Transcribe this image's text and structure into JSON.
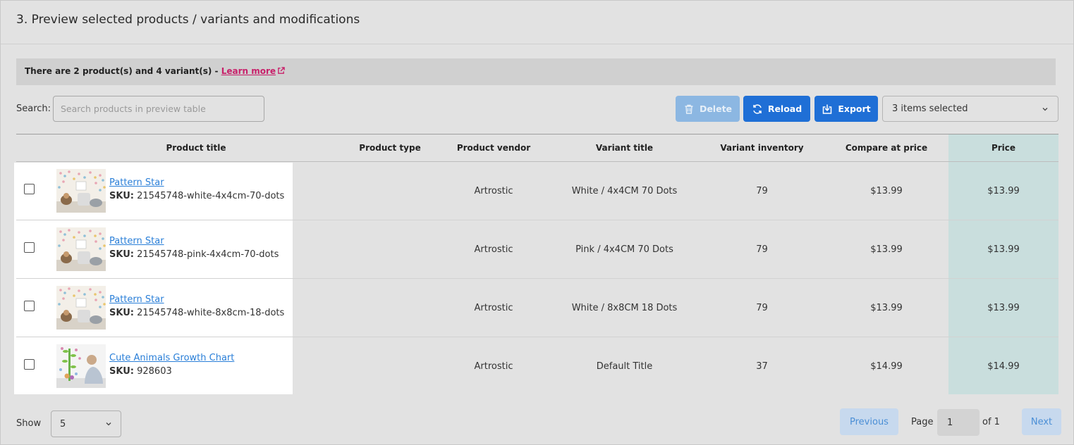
{
  "section_title": "3. Preview selected products / variants and modifications",
  "info": {
    "text": "There are 2 product(s) and 4 variant(s) - ",
    "link_label": "Learn more"
  },
  "search": {
    "label": "Search:",
    "placeholder": "Search products in preview table"
  },
  "toolbar": {
    "delete_label": "Delete",
    "reload_label": "Reload",
    "export_label": "Export",
    "selection_value": "3 items selected"
  },
  "table": {
    "columns": [
      "Product title",
      "Product type",
      "Product vendor",
      "Variant title",
      "Variant inventory",
      "Compare at price",
      "Price"
    ],
    "sku_label": "SKU:",
    "rows": [
      {
        "title": "Pattern Star",
        "sku": "21545748-white-4x4cm-70-dots",
        "type": "",
        "vendor": "Artrostic",
        "variant": "White / 4x4CM 70 Dots",
        "inventory": "79",
        "compare": "$13.99",
        "price": "$13.99",
        "image": "pattern-star"
      },
      {
        "title": "Pattern Star",
        "sku": "21545748-pink-4x4cm-70-dots",
        "type": "",
        "vendor": "Artrostic",
        "variant": "Pink / 4x4CM 70 Dots",
        "inventory": "79",
        "compare": "$13.99",
        "price": "$13.99",
        "image": "pattern-star"
      },
      {
        "title": "Pattern Star",
        "sku": "21545748-white-8x8cm-18-dots",
        "type": "",
        "vendor": "Artrostic",
        "variant": "White / 8x8CM 18 Dots",
        "inventory": "79",
        "compare": "$13.99",
        "price": "$13.99",
        "image": "pattern-star"
      },
      {
        "title": "Cute Animals Growth Chart",
        "sku": "928603",
        "type": "",
        "vendor": "Artrostic",
        "variant": "Default Title",
        "inventory": "37",
        "compare": "$14.99",
        "price": "$14.99",
        "image": "growth-chart"
      }
    ]
  },
  "footer": {
    "show_label": "Show",
    "page_size": "5",
    "previous_label": "Previous",
    "page_label": "Page",
    "page_value": "1",
    "of_label": "of 1",
    "next_label": "Next"
  },
  "colors": {
    "primary": "#1f6fd6",
    "link": "#2a7fd8",
    "learn_more": "#c8206a",
    "price_column": "#c9dedd"
  }
}
